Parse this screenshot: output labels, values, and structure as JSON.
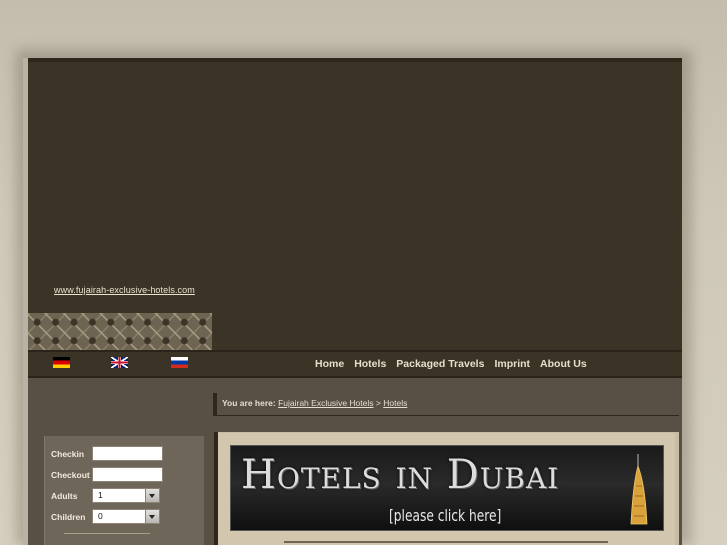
{
  "header": {
    "site_link": "www.fujairah-exclusive-hotels.com"
  },
  "languages": [
    {
      "name": "german-flag"
    },
    {
      "name": "uk-flag"
    },
    {
      "name": "russian-flag"
    }
  ],
  "nav": {
    "items": [
      "Home",
      "Hotels",
      "Packaged Travels",
      "Imprint",
      "About Us"
    ]
  },
  "breadcrumb": {
    "label": "You are here:",
    "links": [
      "Fujairah Exclusive Hotels",
      "Hotels"
    ],
    "separator": ">"
  },
  "booking_form": {
    "checkin_label": "Checkin",
    "checkin_value": "",
    "checkout_label": "Checkout",
    "checkout_value": "",
    "adults_label": "Adults",
    "adults_value": "1",
    "children_label": "Children",
    "children_value": "0"
  },
  "banner": {
    "title": "Hotels in Dubai",
    "subtitle": "[please click here]"
  },
  "colors": {
    "page_bg": "#3b3326",
    "content_bg": "#585045",
    "main_box": "#d2c7ae",
    "nav_text": "#e6dfcc"
  }
}
